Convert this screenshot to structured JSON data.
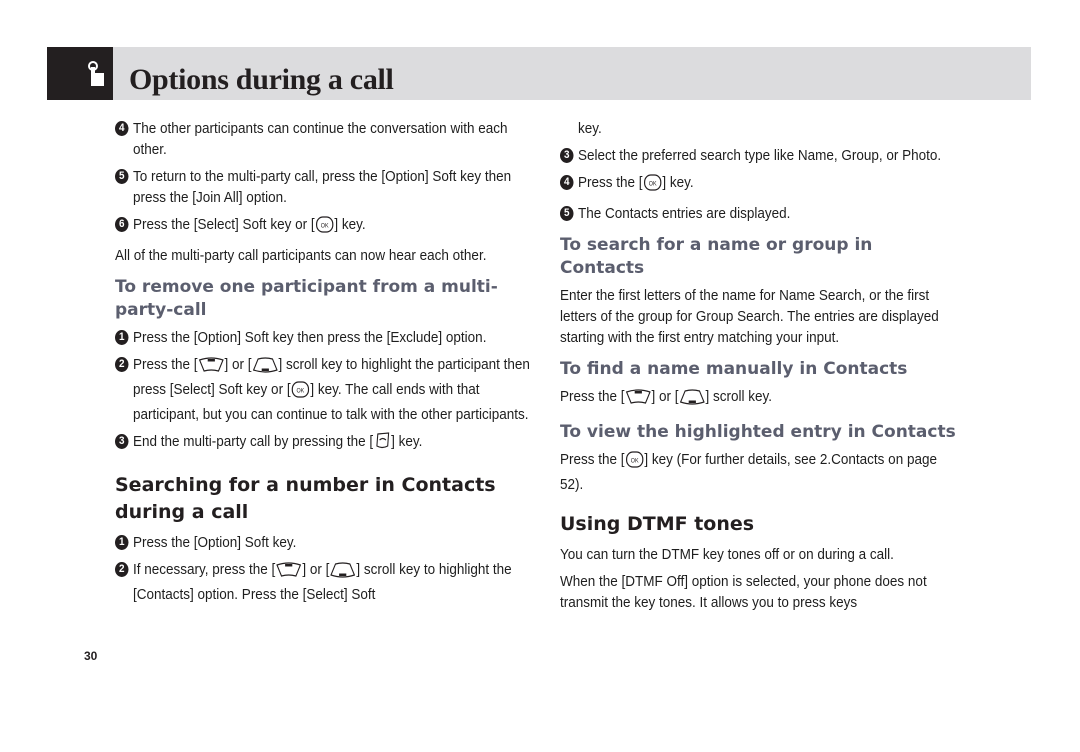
{
  "header": {
    "title": "Options during a call",
    "icon": "hand-pointer-icon"
  },
  "page_number": "30",
  "left_column": {
    "continued_steps": [
      {
        "num": "4",
        "text": "The other participants can continue the conversation with each other."
      },
      {
        "num": "5",
        "text": "To return to the multi-party call, press the [Option] Soft key then press the [Join All] option."
      },
      {
        "num": "6",
        "text_before": "Press the [Select] Soft key or [",
        "key": "ok-key-icon",
        "text_after": "] key."
      }
    ],
    "note": "All of the multi-party call participants can now hear each other.",
    "remove_section": {
      "heading": "To remove one participant from a multi-party-call",
      "steps": [
        {
          "num": "1",
          "text": "Press the [Option] Soft key then press the [Exclude] option."
        },
        {
          "num": "2",
          "text_a": "Press the [",
          "key_a": "scroll-up-key-icon",
          "text_b": "] or [",
          "key_b": "scroll-down-key-icon",
          "text_c": "] scroll key to highlight the participant then press [Select] Soft key or [",
          "key_c": "ok-key-icon",
          "text_d": "] key. The call ends with that participant, but you can continue to talk with the other participants."
        },
        {
          "num": "3",
          "text_before": "End the multi-party call by pressing the [",
          "key": "end-key-icon",
          "text_after": "] key."
        }
      ]
    },
    "search_section": {
      "heading": "Searching for a number in Contacts during a call",
      "steps": [
        {
          "num": "1",
          "text": "Press the [Option] Soft key."
        },
        {
          "num": "2",
          "text_a": "If necessary, press the [",
          "key_a": "scroll-up-key-icon",
          "text_b": "] or [",
          "key_b": "scroll-down-key-icon",
          "text_c": "] scroll key to highlight the [Contacts] option. Press the [Select] Soft"
        }
      ]
    }
  },
  "right_column": {
    "continuation": "key.",
    "steps": [
      {
        "num": "3",
        "text": "Select the preferred search type like Name, Group, or Photo."
      },
      {
        "num": "4",
        "text_before": "Press the [",
        "key": "ok-key-icon",
        "text_after": "] key."
      },
      {
        "num": "5",
        "text": "The Contacts entries are displayed."
      }
    ],
    "name_group_section": {
      "heading": "To search for a name or group in Contacts",
      "body": "Enter the first letters of the name for Name Search, or the first letters of the group for Group Search. The entries are displayed starting with the first entry matching your input."
    },
    "manual_section": {
      "heading": "To find a name manually in Contacts",
      "text_a": "Press the [",
      "key_a": "scroll-up-key-icon",
      "text_b": "] or [",
      "key_b": "scroll-down-key-icon",
      "text_c": "] scroll key."
    },
    "view_section": {
      "heading": "To view the highlighted entry in Contacts",
      "text_before": "Press the [",
      "key": "ok-key-icon",
      "text_after": "] key (For further details, see 2.Contacts on page 52)."
    },
    "dtmf_section": {
      "heading": "Using DTMF tones",
      "paragraphs": [
        "You can turn the DTMF key tones off or on during a call.",
        "When the [DTMF Off] option is selected, your phone does not transmit the key tones. It allows you to press keys"
      ]
    }
  }
}
